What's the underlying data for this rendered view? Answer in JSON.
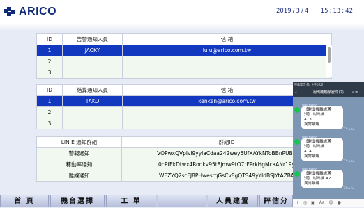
{
  "header": {
    "logo_text": "ARICO",
    "date_year": "2019",
    "date_month": "3",
    "date_day": "4",
    "time_h": "15",
    "time_m": "13",
    "time_s": "42"
  },
  "alarm_notify": {
    "columns": [
      "ID",
      "告警通知人員",
      "信 箱"
    ],
    "rows": [
      {
        "id": "1",
        "person": "JACKY",
        "email": "lulu@arico.com.tw"
      },
      {
        "id": "2",
        "person": "",
        "email": ""
      },
      {
        "id": "3",
        "person": "",
        "email": ""
      }
    ]
  },
  "result_notify": {
    "columns": [
      "ID",
      "結算通知人員",
      "信 箱"
    ],
    "rows": [
      {
        "id": "1",
        "person": "TAKO",
        "email": "kenken@arico.com.tw"
      },
      {
        "id": "2",
        "person": "",
        "email": ""
      },
      {
        "id": "3",
        "person": "",
        "email": ""
      }
    ]
  },
  "line_groups": {
    "columns": [
      "LIN E 通知群組",
      "群組ID"
    ],
    "rows": [
      {
        "name": "警報通知",
        "group_id": "VOPwxQVplvl9yylaCdaa242wey5UfXAYkNToBBnPUBX"
      },
      {
        "name": "稼動率通知",
        "group_id": "0cPfEkDtwx4Ronkv95t8jmw9tO7rFPrkHgMcaANr19y"
      },
      {
        "name": "離線通知",
        "group_id": "WEZYQ2scFJ8PHwesrqGsCv8gQTS49yYldBSJYtAZBA"
      }
    ]
  },
  "nav": {
    "home": "首 頁",
    "machine_select": "機台選擇",
    "work_order": "工 單",
    "personnel": "人員建置",
    "evaluation": "評估分"
  },
  "phone": {
    "status": "中華電信 4G    下午6:00",
    "title": "射出機離線通知 (2)",
    "sender": "LINE Notify",
    "messages": [
      {
        "l1": "【射出機離線通",
        "l2": "知】 射出機",
        "l3": "A13",
        "l4": "異常離線",
        "time": "下午6:00"
      },
      {
        "l1": "【射出機離線通",
        "l2": "知】 射出機",
        "l3": "A14",
        "l4": "異常離線",
        "time": "下午6:00"
      },
      {
        "l1": "【射出機離線通",
        "l2": "知】 射出機 A2",
        "l3": "異常離線",
        "l4": "",
        "time": "下午6:00"
      }
    ],
    "input_text": "Aa"
  }
}
